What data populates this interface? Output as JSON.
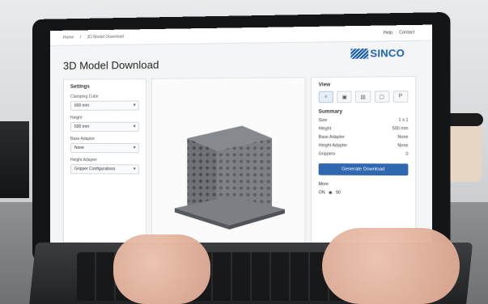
{
  "ui": {
    "breadcrumb": [
      "Home",
      "3D Model Download"
    ],
    "top_links": [
      "Help",
      "Contact"
    ],
    "brand": "SINCO",
    "page_title": "3D Model Download",
    "settings": {
      "title": "Settings",
      "fields": [
        {
          "label": "Clamping Cube",
          "value": "600 mm"
        },
        {
          "label": "Height",
          "value": "500 mm"
        },
        {
          "label": "Base Adapter",
          "value": "None"
        },
        {
          "label": "Height Adapter",
          "value": "Gripper Configurations"
        }
      ]
    },
    "view": {
      "title": "View",
      "buttons": [
        "search-icon",
        "cube-icon",
        "image-icon",
        "frame-icon",
        "text-icon"
      ]
    },
    "summary": {
      "title": "Summary",
      "rows": [
        {
          "label": "Size",
          "value": "1 x 1"
        },
        {
          "label": "Height",
          "value": "500 mm"
        },
        {
          "label": "Base Adapter",
          "value": "None"
        },
        {
          "label": "Height Adapter",
          "value": "None"
        },
        {
          "label": "Grippers",
          "value": "0"
        }
      ],
      "button": "Generate Download"
    },
    "more": {
      "label": "More",
      "a": "ON",
      "b": "90"
    }
  }
}
